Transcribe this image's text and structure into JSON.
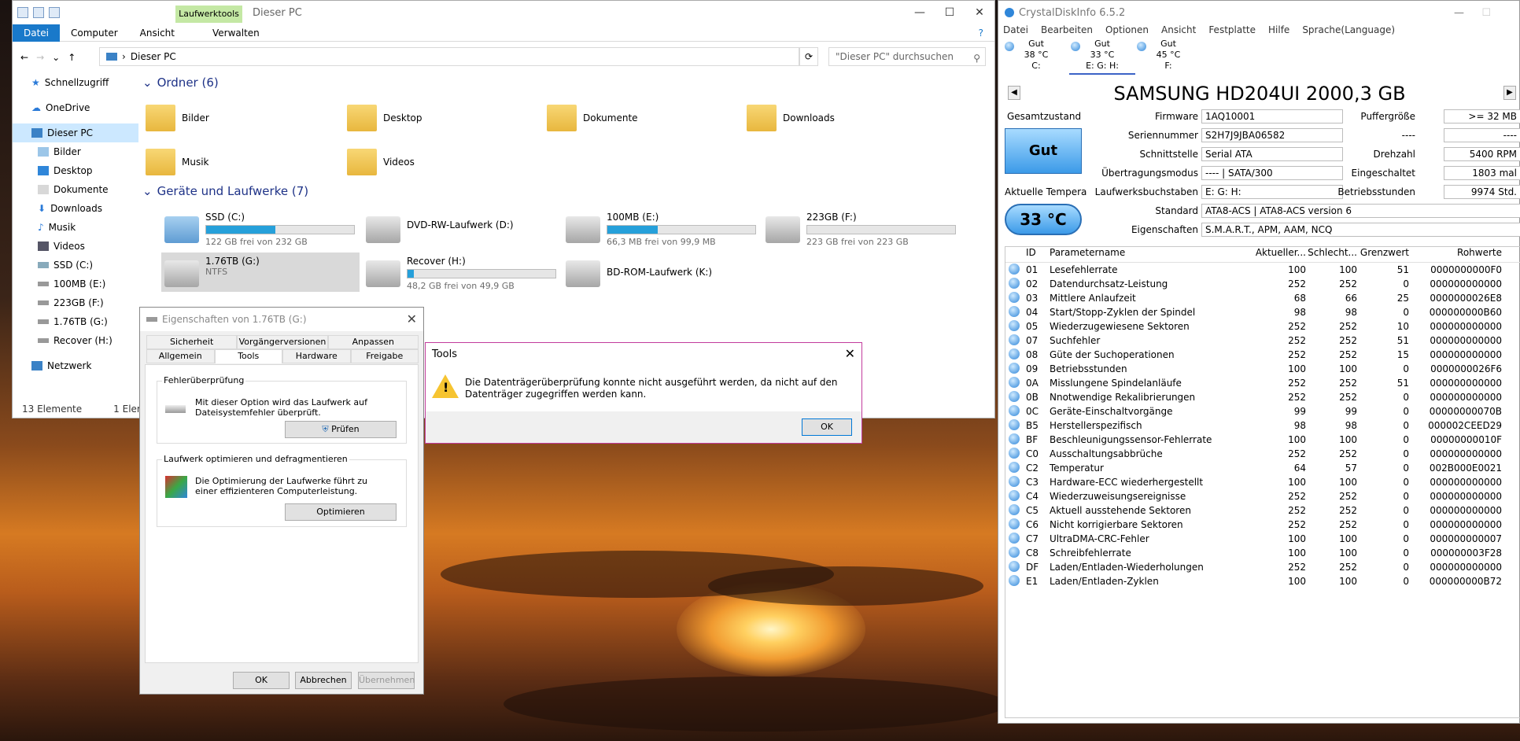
{
  "explorer": {
    "tool_tab": "Laufwerktools",
    "title": "Dieser PC",
    "ribbon": [
      "Datei",
      "Computer",
      "Ansicht",
      "Verwalten"
    ],
    "address": "Dieser PC",
    "search_placeholder": "\"Dieser PC\" durchsuchen",
    "nav": [
      "Schnellzugriff",
      "OneDrive",
      "Dieser PC",
      "Bilder",
      "Desktop",
      "Dokumente",
      "Downloads",
      "Musik",
      "Videos",
      "SSD (C:)",
      "100MB (E:)",
      "223GB (F:)",
      "1.76TB (G:)",
      "Recover (H:)",
      "Netzwerk"
    ],
    "folders_header": "Ordner (6)",
    "folders": [
      "Bilder",
      "Desktop",
      "Dokumente",
      "Downloads",
      "Musik",
      "Videos"
    ],
    "drives_header": "Geräte und Laufwerke (7)",
    "drives": [
      {
        "name": "SSD (C:)",
        "free": "122 GB frei von 232 GB",
        "used": 0.47
      },
      {
        "name": "DVD-RW-Laufwerk (D:)",
        "free": ""
      },
      {
        "name": "100MB (E:)",
        "free": "66,3 MB frei von 99,9 MB",
        "used": 0.34
      },
      {
        "name": "223GB (F:)",
        "free": "223 GB frei von 223 GB",
        "used": 0.0
      },
      {
        "name": "1.76TB (G:)",
        "free": "NTFS"
      },
      {
        "name": "Recover (H:)",
        "free": "48,2 GB frei von 49,9 GB",
        "used": 0.04
      },
      {
        "name": "BD-ROM-Laufwerk (K:)",
        "free": ""
      }
    ],
    "status_count": "13 Elemente",
    "status_selected": "1 Element a"
  },
  "props": {
    "title": "Eigenschaften von 1.76TB (G:)",
    "tabs_row1": [
      "Sicherheit",
      "Vorgängerversionen",
      "Anpassen"
    ],
    "tabs_row2": [
      "Allgemein",
      "Tools",
      "Hardware",
      "Freigabe"
    ],
    "check_title": "Fehlerüberprüfung",
    "check_text": "Mit dieser Option wird das Laufwerk auf Dateisystemfehler überprüft.",
    "check_btn": "Prüfen",
    "opt_title": "Laufwerk optimieren und defragmentieren",
    "opt_text": "Die Optimierung der Laufwerke führt zu einer effizienteren Computerleistung.",
    "opt_btn": "Optimieren",
    "ok": "OK",
    "cancel": "Abbrechen",
    "apply": "Übernehmen"
  },
  "tools": {
    "title": "Tools",
    "message": "Die Datenträgerüberprüfung konnte nicht ausgeführt werden, da nicht auf den Datenträger zugegriffen werden kann.",
    "ok": "OK"
  },
  "cdi": {
    "title": "CrystalDiskInfo 6.5.2",
    "menu": [
      "Datei",
      "Bearbeiten",
      "Optionen",
      "Ansicht",
      "Festplatte",
      "Hilfe",
      "Sprache(Language)"
    ],
    "disk_tabs": [
      {
        "status": "Gut",
        "temp": "38 °C",
        "letters": "C:"
      },
      {
        "status": "Gut",
        "temp": "33 °C",
        "letters": "E: G: H:"
      },
      {
        "status": "Gut",
        "temp": "45 °C",
        "letters": "F:"
      }
    ],
    "model": "SAMSUNG HD204UI 2000,3 GB",
    "health_label": "Gesamtzustand",
    "health": "Gut",
    "temp_label": "Aktuelle Tempera",
    "temp": "33 °C",
    "info": [
      {
        "label": "Firmware",
        "value": "1AQ10001"
      },
      {
        "label": "Seriennummer",
        "value": "S2H7J9JBA06582"
      },
      {
        "label": "Schnittstelle",
        "value": "Serial ATA"
      },
      {
        "label": "Übertragungsmodus",
        "value": "---- | SATA/300"
      },
      {
        "label": "Laufwerksbuchstaben",
        "value": "E: G: H:"
      }
    ],
    "standard_label": "Standard",
    "standard": "ATA8-ACS | ATA8-ACS version 6",
    "features_label": "Eigenschaften",
    "features": "S.M.A.R.T., APM, AAM, NCQ",
    "right": [
      {
        "label": "Puffergröße",
        "value": ">= 32 MB"
      },
      {
        "label": "----",
        "value": "----"
      },
      {
        "label": "Drehzahl",
        "value": "5400 RPM"
      },
      {
        "label": "Eingeschaltet",
        "value": "1803 mal"
      },
      {
        "label": "Betriebsstunden",
        "value": "9974 Std."
      }
    ],
    "columns": [
      "ID",
      "Parametername",
      "Aktueller...",
      "Schlecht...",
      "Grenzwert",
      "Rohwerte"
    ],
    "rows": [
      [
        "01",
        "Lesefehlerrate",
        "100",
        "100",
        "51",
        "0000000000F0"
      ],
      [
        "02",
        "Datendurchsatz-Leistung",
        "252",
        "252",
        "0",
        "000000000000"
      ],
      [
        "03",
        "Mittlere Anlaufzeit",
        "68",
        "66",
        "25",
        "0000000026E8"
      ],
      [
        "04",
        "Start/Stopp-Zyklen der Spindel",
        "98",
        "98",
        "0",
        "000000000B60"
      ],
      [
        "05",
        "Wiederzugewiesene Sektoren",
        "252",
        "252",
        "10",
        "000000000000"
      ],
      [
        "07",
        "Suchfehler",
        "252",
        "252",
        "51",
        "000000000000"
      ],
      [
        "08",
        "Güte der Suchoperationen",
        "252",
        "252",
        "15",
        "000000000000"
      ],
      [
        "09",
        "Betriebsstunden",
        "100",
        "100",
        "0",
        "0000000026F6"
      ],
      [
        "0A",
        "Misslungene Spindelanläufe",
        "252",
        "252",
        "51",
        "000000000000"
      ],
      [
        "0B",
        "Nnotwendige Rekalibrierungen",
        "252",
        "252",
        "0",
        "000000000000"
      ],
      [
        "0C",
        "Geräte-Einschaltvorgänge",
        "99",
        "99",
        "0",
        "00000000070B"
      ],
      [
        "B5",
        "Herstellerspezifisch",
        "98",
        "98",
        "0",
        "000002CEED29"
      ],
      [
        "BF",
        "Beschleunigungssensor-Fehlerrate",
        "100",
        "100",
        "0",
        "00000000010F"
      ],
      [
        "C0",
        "Ausschaltungsabbrüche",
        "252",
        "252",
        "0",
        "000000000000"
      ],
      [
        "C2",
        "Temperatur",
        "64",
        "57",
        "0",
        "002B000E0021"
      ],
      [
        "C3",
        "Hardware-ECC wiederhergestellt",
        "100",
        "100",
        "0",
        "000000000000"
      ],
      [
        "C4",
        "Wiederzuweisungsereignisse",
        "252",
        "252",
        "0",
        "000000000000"
      ],
      [
        "C5",
        "Aktuell ausstehende Sektoren",
        "252",
        "252",
        "0",
        "000000000000"
      ],
      [
        "C6",
        "Nicht korrigierbare Sektoren",
        "252",
        "252",
        "0",
        "000000000000"
      ],
      [
        "C7",
        "UltraDMA-CRC-Fehler",
        "100",
        "100",
        "0",
        "000000000007"
      ],
      [
        "C8",
        "Schreibfehlerrate",
        "100",
        "100",
        "0",
        "000000003F28"
      ],
      [
        "DF",
        "Laden/Entladen-Wiederholungen",
        "252",
        "252",
        "0",
        "000000000000"
      ],
      [
        "E1",
        "Laden/Entladen-Zyklen",
        "100",
        "100",
        "0",
        "000000000B72"
      ]
    ]
  }
}
